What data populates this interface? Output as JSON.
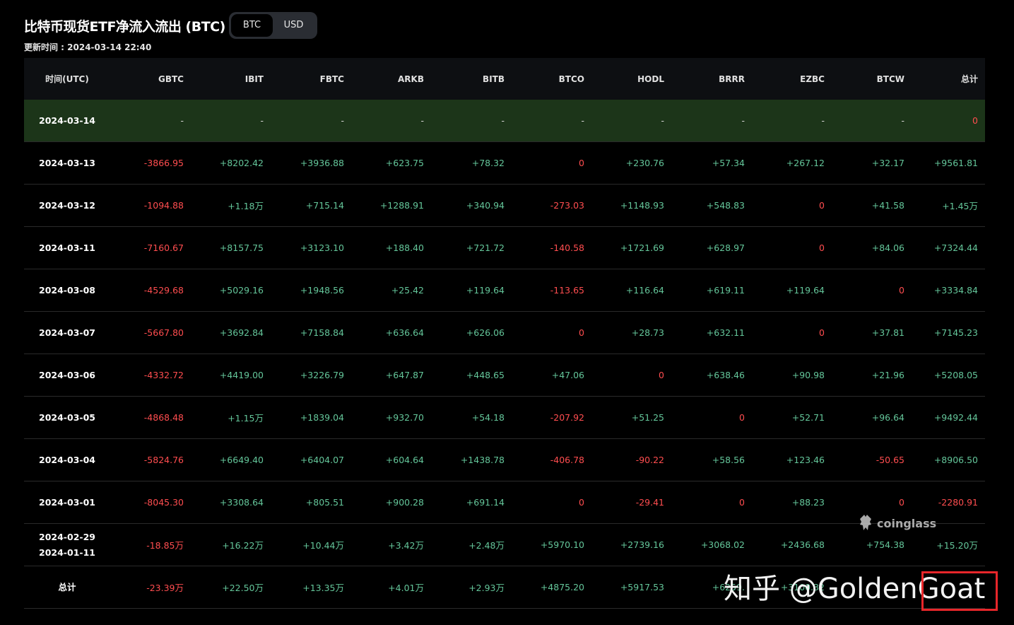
{
  "header": {
    "title": "比特币现货ETF净流入流出 (BTC)",
    "update_time": "更新时间 : 2024-03-14 22:40",
    "toggle": [
      "BTC",
      "USD"
    ],
    "toggle_active": "BTC"
  },
  "table": {
    "columns": [
      "时间(UTC)",
      "GBTC",
      "IBIT",
      "FBTC",
      "ARKB",
      "BITB",
      "BTCO",
      "HODL",
      "BRRR",
      "EZBC",
      "BTCW",
      "总计"
    ],
    "rows": [
      {
        "date": "2024-03-14",
        "date2": "",
        "values": [
          "-",
          "-",
          "-",
          "-",
          "-",
          "-",
          "-",
          "-",
          "-",
          "-",
          "0"
        ],
        "signs": [
          "neu",
          "neu",
          "neu",
          "neu",
          "neu",
          "neu",
          "neu",
          "neu",
          "neu",
          "neu",
          "neg"
        ],
        "highlight": true
      },
      {
        "date": "2024-03-13",
        "date2": "",
        "values": [
          "-3866.95",
          "+8202.42",
          "+3936.88",
          "+623.75",
          "+78.32",
          "0",
          "+230.76",
          "+57.34",
          "+267.12",
          "+32.17",
          "+9561.81"
        ],
        "signs": [
          "neg",
          "pos",
          "pos",
          "pos",
          "pos",
          "neg",
          "pos",
          "pos",
          "pos",
          "pos",
          "pos"
        ]
      },
      {
        "date": "2024-03-12",
        "date2": "",
        "values": [
          "-1094.88",
          "+1.18万",
          "+715.14",
          "+1288.91",
          "+340.94",
          "-273.03",
          "+1148.93",
          "+548.83",
          "0",
          "+41.58",
          "+1.45万"
        ],
        "signs": [
          "neg",
          "pos",
          "pos",
          "pos",
          "pos",
          "neg",
          "pos",
          "pos",
          "neg",
          "pos",
          "pos"
        ]
      },
      {
        "date": "2024-03-11",
        "date2": "",
        "values": [
          "-7160.67",
          "+8157.75",
          "+3123.10",
          "+188.40",
          "+721.72",
          "-140.58",
          "+1721.69",
          "+628.97",
          "0",
          "+84.06",
          "+7324.44"
        ],
        "signs": [
          "neg",
          "pos",
          "pos",
          "pos",
          "pos",
          "neg",
          "pos",
          "pos",
          "neg",
          "pos",
          "pos"
        ]
      },
      {
        "date": "2024-03-08",
        "date2": "",
        "values": [
          "-4529.68",
          "+5029.16",
          "+1948.56",
          "+25.42",
          "+119.64",
          "-113.65",
          "+116.64",
          "+619.11",
          "+119.64",
          "0",
          "+3334.84"
        ],
        "signs": [
          "neg",
          "pos",
          "pos",
          "pos",
          "pos",
          "neg",
          "pos",
          "pos",
          "pos",
          "neg",
          "pos"
        ]
      },
      {
        "date": "2024-03-07",
        "date2": "",
        "values": [
          "-5667.80",
          "+3692.84",
          "+7158.84",
          "+636.64",
          "+626.06",
          "0",
          "+28.73",
          "+632.11",
          "0",
          "+37.81",
          "+7145.23"
        ],
        "signs": [
          "neg",
          "pos",
          "pos",
          "pos",
          "pos",
          "neg",
          "pos",
          "pos",
          "neg",
          "pos",
          "pos"
        ]
      },
      {
        "date": "2024-03-06",
        "date2": "",
        "values": [
          "-4332.72",
          "+4419.00",
          "+3226.79",
          "+647.87",
          "+448.65",
          "+47.06",
          "0",
          "+638.46",
          "+90.98",
          "+21.96",
          "+5208.05"
        ],
        "signs": [
          "neg",
          "pos",
          "pos",
          "pos",
          "pos",
          "pos",
          "neg",
          "pos",
          "pos",
          "pos",
          "pos"
        ]
      },
      {
        "date": "2024-03-05",
        "date2": "",
        "values": [
          "-4868.48",
          "+1.15万",
          "+1839.04",
          "+932.70",
          "+54.18",
          "-207.92",
          "+51.25",
          "0",
          "+52.71",
          "+96.64",
          "+9492.44"
        ],
        "signs": [
          "neg",
          "pos",
          "pos",
          "pos",
          "pos",
          "neg",
          "pos",
          "neg",
          "pos",
          "pos",
          "pos"
        ]
      },
      {
        "date": "2024-03-04",
        "date2": "",
        "values": [
          "-5824.76",
          "+6649.40",
          "+6404.07",
          "+604.64",
          "+1438.78",
          "-406.78",
          "-90.22",
          "+58.56",
          "+123.46",
          "-50.65",
          "+8906.50"
        ],
        "signs": [
          "neg",
          "pos",
          "pos",
          "pos",
          "pos",
          "neg",
          "neg",
          "pos",
          "pos",
          "neg",
          "pos"
        ]
      },
      {
        "date": "2024-03-01",
        "date2": "",
        "values": [
          "-8045.30",
          "+3308.64",
          "+805.51",
          "+900.28",
          "+691.14",
          "0",
          "-29.41",
          "0",
          "+88.23",
          "0",
          "-2280.91"
        ],
        "signs": [
          "neg",
          "pos",
          "pos",
          "pos",
          "pos",
          "neg",
          "neg",
          "neg",
          "pos",
          "neg",
          "neg"
        ]
      },
      {
        "date": "2024-02-29",
        "date2": "2024-01-11",
        "values": [
          "-18.85万",
          "+16.22万",
          "+10.44万",
          "+3.42万",
          "+2.48万",
          "+5970.10",
          "+2739.16",
          "+3068.02",
          "+2436.68",
          "+754.38",
          "+15.20万"
        ],
        "signs": [
          "neg",
          "pos",
          "pos",
          "pos",
          "pos",
          "pos",
          "pos",
          "pos",
          "pos",
          "pos",
          "pos"
        ]
      },
      {
        "date": "总计",
        "date2": "",
        "values": [
          "-23.39万",
          "+22.50万",
          "+13.35万",
          "+4.01万",
          "+2.93万",
          "+4875.20",
          "+5917.53",
          "+6259.",
          "+3100.32",
          "",
          ""
        ],
        "signs": [
          "neg",
          "pos",
          "pos",
          "pos",
          "pos",
          "pos",
          "pos",
          "pos",
          "pos",
          "pos",
          "pos"
        ]
      }
    ]
  },
  "watermarks": {
    "logo": "coinglass",
    "zhihu": "知乎 @GoldenGoat"
  },
  "colors": {
    "positive": "#64c69a",
    "negative": "#ff4d4f",
    "highlight_row": "#1c3519",
    "annotation_box": "#e8262a"
  }
}
